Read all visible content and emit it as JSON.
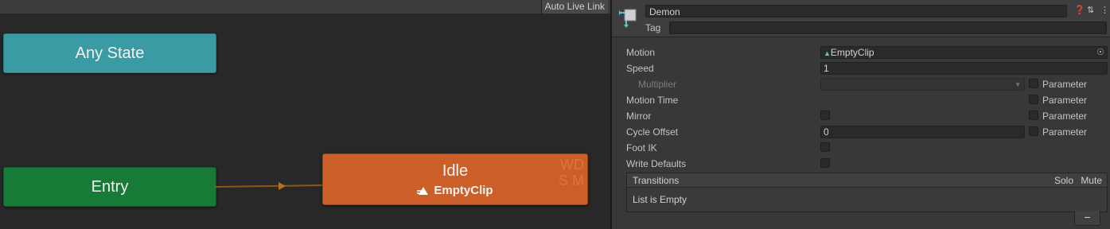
{
  "graph": {
    "auto_live_link": "Auto Live Link",
    "any_state": "Any State",
    "entry": "Entry",
    "idle": {
      "title": "Idle",
      "clip": "EmptyClip",
      "wd_line1": "WD",
      "wd_line2": "S M"
    }
  },
  "inspector": {
    "name": "Demon",
    "tag_label": "Tag",
    "tag_value": "",
    "motion_label": "Motion",
    "motion_value": "EmptyClip",
    "speed_label": "Speed",
    "speed_value": "1",
    "multiplier_label": "Multiplier",
    "motion_time_label": "Motion Time",
    "mirror_label": "Mirror",
    "cycle_offset_label": "Cycle Offset",
    "cycle_offset_value": "0",
    "foot_ik_label": "Foot IK",
    "write_defaults_label": "Write Defaults",
    "parameter_label": "Parameter",
    "transitions": {
      "title": "Transitions",
      "solo": "Solo",
      "mute": "Mute",
      "empty": "List is Empty",
      "remove": "−"
    }
  },
  "colors": {
    "any_state": "#3a9ba5",
    "entry": "#177a36",
    "idle": "#cb5f27"
  }
}
